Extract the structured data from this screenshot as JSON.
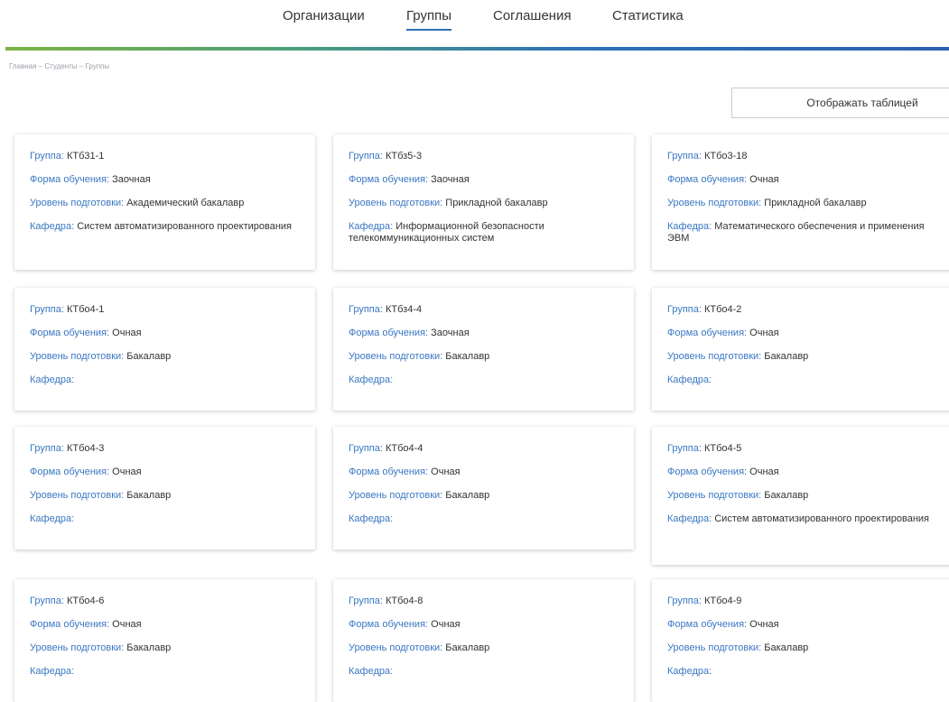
{
  "nav": {
    "items": [
      {
        "label": "Организации",
        "active": false
      },
      {
        "label": "Группы",
        "active": true
      },
      {
        "label": "Соглашения",
        "active": false
      },
      {
        "label": "Статистика",
        "active": false
      }
    ],
    "accent_color": "#2f6fb5"
  },
  "breadcrumb": "Главная – Студенты – Группы",
  "view_toggle_label": "Отображать таблицей",
  "labels": {
    "group": "Группа:",
    "form": "Форма обучения:",
    "level": "Уровень подготовки:",
    "department": "Кафедра:"
  },
  "label_color": "#3a78c2",
  "groups": [
    {
      "group": "КТб31-1",
      "form": "Заочная",
      "level": "Академический бакалавр",
      "department": "Систем автоматизированного проектирования"
    },
    {
      "group": "КТбз5-3",
      "form": "Заочная",
      "level": "Прикладной бакалавр",
      "department": "Информационной безопасности телекоммуникационных систем"
    },
    {
      "group": "КТбо3-18",
      "form": "Очная",
      "level": "Прикладной бакалавр",
      "department": "Математического обеспечения и применения ЭВМ"
    },
    {
      "group": "КТбо4-1",
      "form": "Очная",
      "level": "Бакалавр",
      "department": ""
    },
    {
      "group": "КТбз4-4",
      "form": "Заочная",
      "level": "Бакалавр",
      "department": ""
    },
    {
      "group": "КТбо4-2",
      "form": "Очная",
      "level": "Бакалавр",
      "department": ""
    },
    {
      "group": "КТбо4-3",
      "form": "Очная",
      "level": "Бакалавр",
      "department": ""
    },
    {
      "group": "КТбо4-4",
      "form": "Очная",
      "level": "Бакалавр",
      "department": ""
    },
    {
      "group": "КТбо4-5",
      "form": "Очная",
      "level": "Бакалавр",
      "department": "Систем автоматизированного проектирования"
    },
    {
      "group": "КТбо4-6",
      "form": "Очная",
      "level": "Бакалавр",
      "department": ""
    },
    {
      "group": "КТбо4-8",
      "form": "Очная",
      "level": "Бакалавр",
      "department": ""
    },
    {
      "group": "КТбо4-9",
      "form": "Очная",
      "level": "Бакалавр",
      "department": ""
    }
  ]
}
